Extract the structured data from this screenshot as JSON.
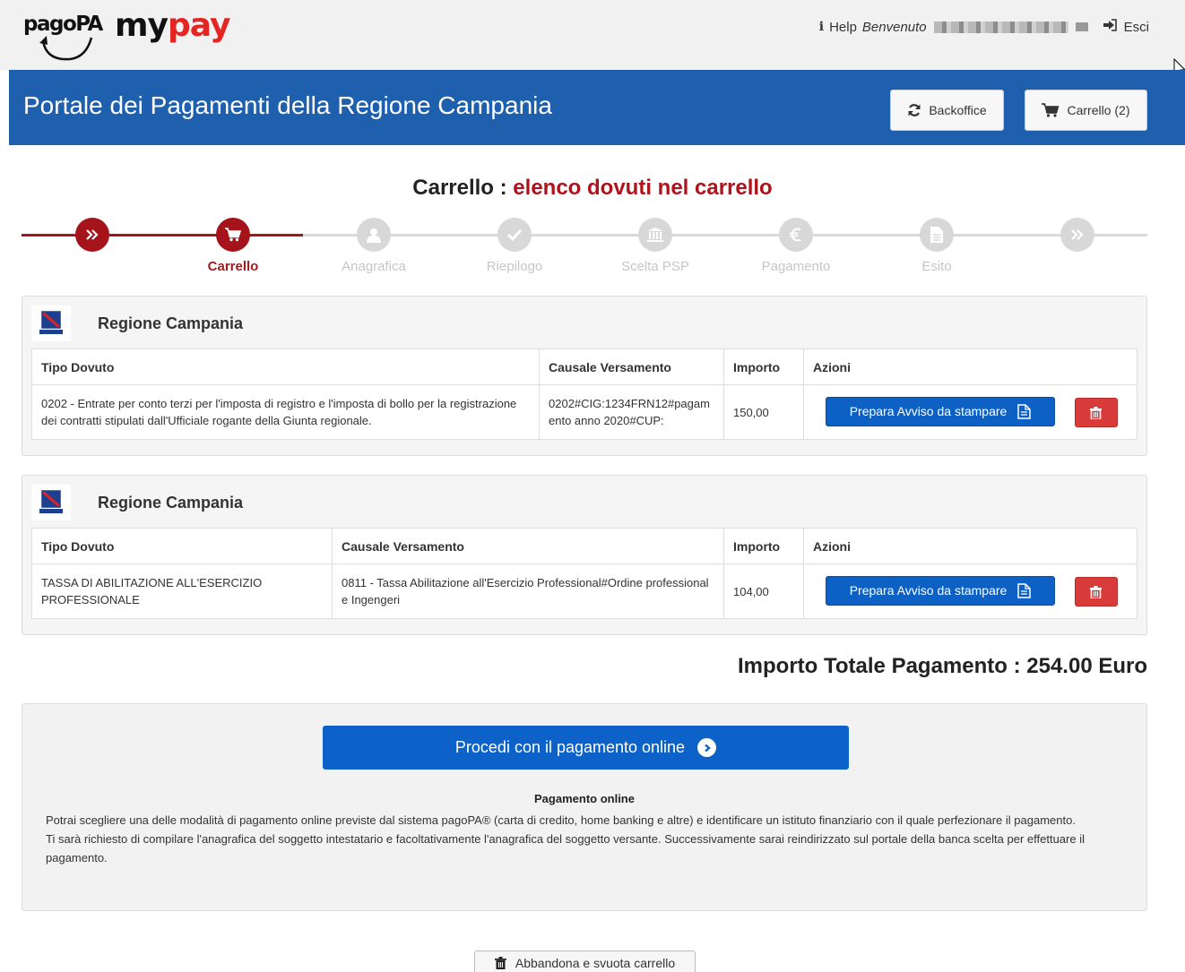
{
  "header_top": {
    "logo_pagopa": "pagoPA",
    "logo_my": "my",
    "logo_pay": "pay",
    "info_glyph": "i",
    "help": "Help",
    "welcome": "Benvenuto",
    "exit": "Esci"
  },
  "header": {
    "title": "Portale dei Pagamenti della Regione Campania",
    "backoffice_label": "Backoffice",
    "cart_label": "Carrello (2)"
  },
  "page": {
    "title_prefix": "Carrello : ",
    "title_suffix": "elenco dovuti nel carrello"
  },
  "stepper": {
    "steps": [
      {
        "label": "",
        "icon": "double-chevron-icon",
        "state": "done"
      },
      {
        "label": "Carrello",
        "icon": "cart-icon",
        "state": "active"
      },
      {
        "label": "Anagrafica",
        "icon": "user-icon",
        "state": "pending"
      },
      {
        "label": "Riepilogo",
        "icon": "check-icon",
        "state": "pending"
      },
      {
        "label": "Scelta PSP",
        "icon": "bank-icon",
        "state": "pending"
      },
      {
        "label": "Pagamento",
        "icon": "euro-icon",
        "state": "pending"
      },
      {
        "label": "Esito",
        "icon": "document-icon",
        "state": "pending"
      },
      {
        "label": "",
        "icon": "double-chevron-icon",
        "state": "pending"
      }
    ]
  },
  "table_headers": {
    "tipo": "Tipo Dovuto",
    "causale": "Causale Versamento",
    "importo": "Importo",
    "azioni": "Azioni"
  },
  "groups": [
    {
      "entity": "Regione Campania",
      "rows": [
        {
          "tipo": "0202 - Entrate per conto terzi per l'imposta di registro e l'imposta di bollo per la registrazione dei contratti stipulati dall'Ufficiale rogante della Giunta regionale.",
          "causale": "0202#CIG:1234FRN12#pagamento anno 2020#CUP:",
          "importo": "150,00"
        }
      ]
    },
    {
      "entity": "Regione Campania",
      "rows": [
        {
          "tipo": "TASSA DI ABILITAZIONE ALL'ESERCIZIO PROFESSIONALE",
          "causale": "0811 - Tassa Abilitazione all'Esercizio Professional#Ordine professionale Ingengeri",
          "importo": "104,00"
        }
      ]
    }
  ],
  "actions": {
    "prepare_label": "Prepara Avviso da stampare"
  },
  "total": {
    "label": "Importo Totale Pagamento : 254.00 Euro"
  },
  "payment": {
    "proceed_label": "Procedi con il pagamento online",
    "heading": "Pagamento online",
    "paragraph1": "Potrai scegliere una delle modalità di pagamento online previste dal sistema pagoPA® (carta di credito, home banking e altre) e identificare un istituto finanziario con il quale perfezionare il pagamento.",
    "paragraph2": "Ti sarà richiesto di compilare l'anagrafica del soggetto intestatario e facoltativamente l'anagrafica del soggetto versante. Successivamente sarai reindirizzato sul portale della banca scelta per effettuare il pagamento."
  },
  "abandon_label": "Abbandona e svuota carrello",
  "colors": {
    "header_blue": "#1e5fae",
    "accent_red": "#b0121b",
    "primary_button": "#0d60c4",
    "danger_button": "#d93a3a",
    "step_pending": "#d8d8d8"
  }
}
